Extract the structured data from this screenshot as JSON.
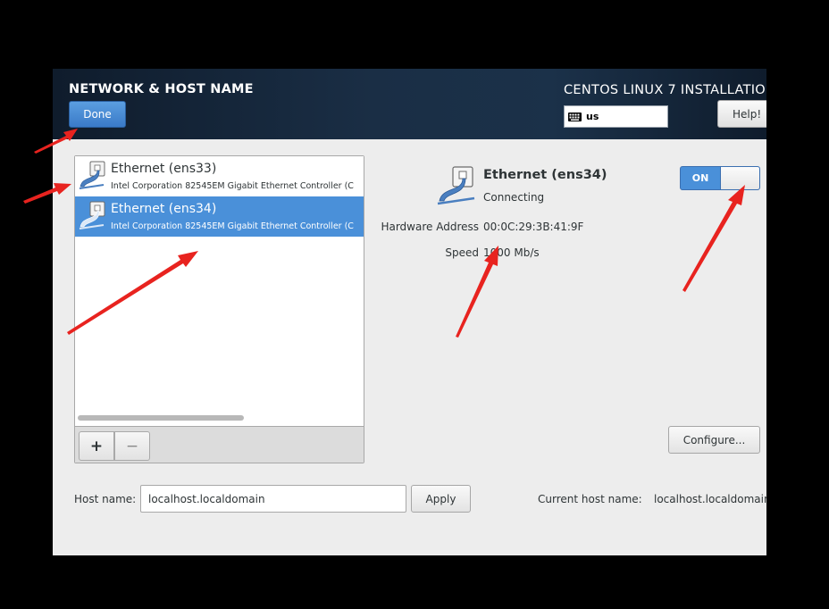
{
  "header": {
    "spoke_title": "NETWORK & HOST NAME",
    "done_label": "Done",
    "product_title": "CENTOS LINUX 7 INSTALLATIO",
    "keyboard_layout": "us",
    "help_label": "Help!"
  },
  "devices": [
    {
      "name": "Ethernet (ens33)",
      "description": "Intel Corporation 82545EM Gigabit Ethernet Controller (C",
      "selected": false,
      "icon": "ethernet-cable-icon"
    },
    {
      "name": "Ethernet (ens34)",
      "description": "Intel Corporation 82545EM Gigabit Ethernet Controller (C",
      "selected": true,
      "icon": "ethernet-cable-icon"
    }
  ],
  "toolbar": {
    "add_label": "+",
    "remove_label": "−"
  },
  "detail": {
    "name": "Ethernet (ens34)",
    "status": "Connecting",
    "hardware_address_label": "Hardware Address",
    "hardware_address": "00:0C:29:3B:41:9F",
    "speed_label": "Speed",
    "speed": "1000 Mb/s",
    "toggle_label": "ON",
    "toggle_on": true,
    "configure_label": "Configure..."
  },
  "hostname": {
    "label": "Host name:",
    "value": "localhost.localdomain",
    "apply_label": "Apply",
    "current_label": "Current host name:",
    "current_value": "localhost.localdomain"
  },
  "colors": {
    "header_bg": "#1a2e45",
    "accent_blue": "#4a90d9",
    "window_bg": "#ededed",
    "annotation_red": "#e8231f"
  }
}
